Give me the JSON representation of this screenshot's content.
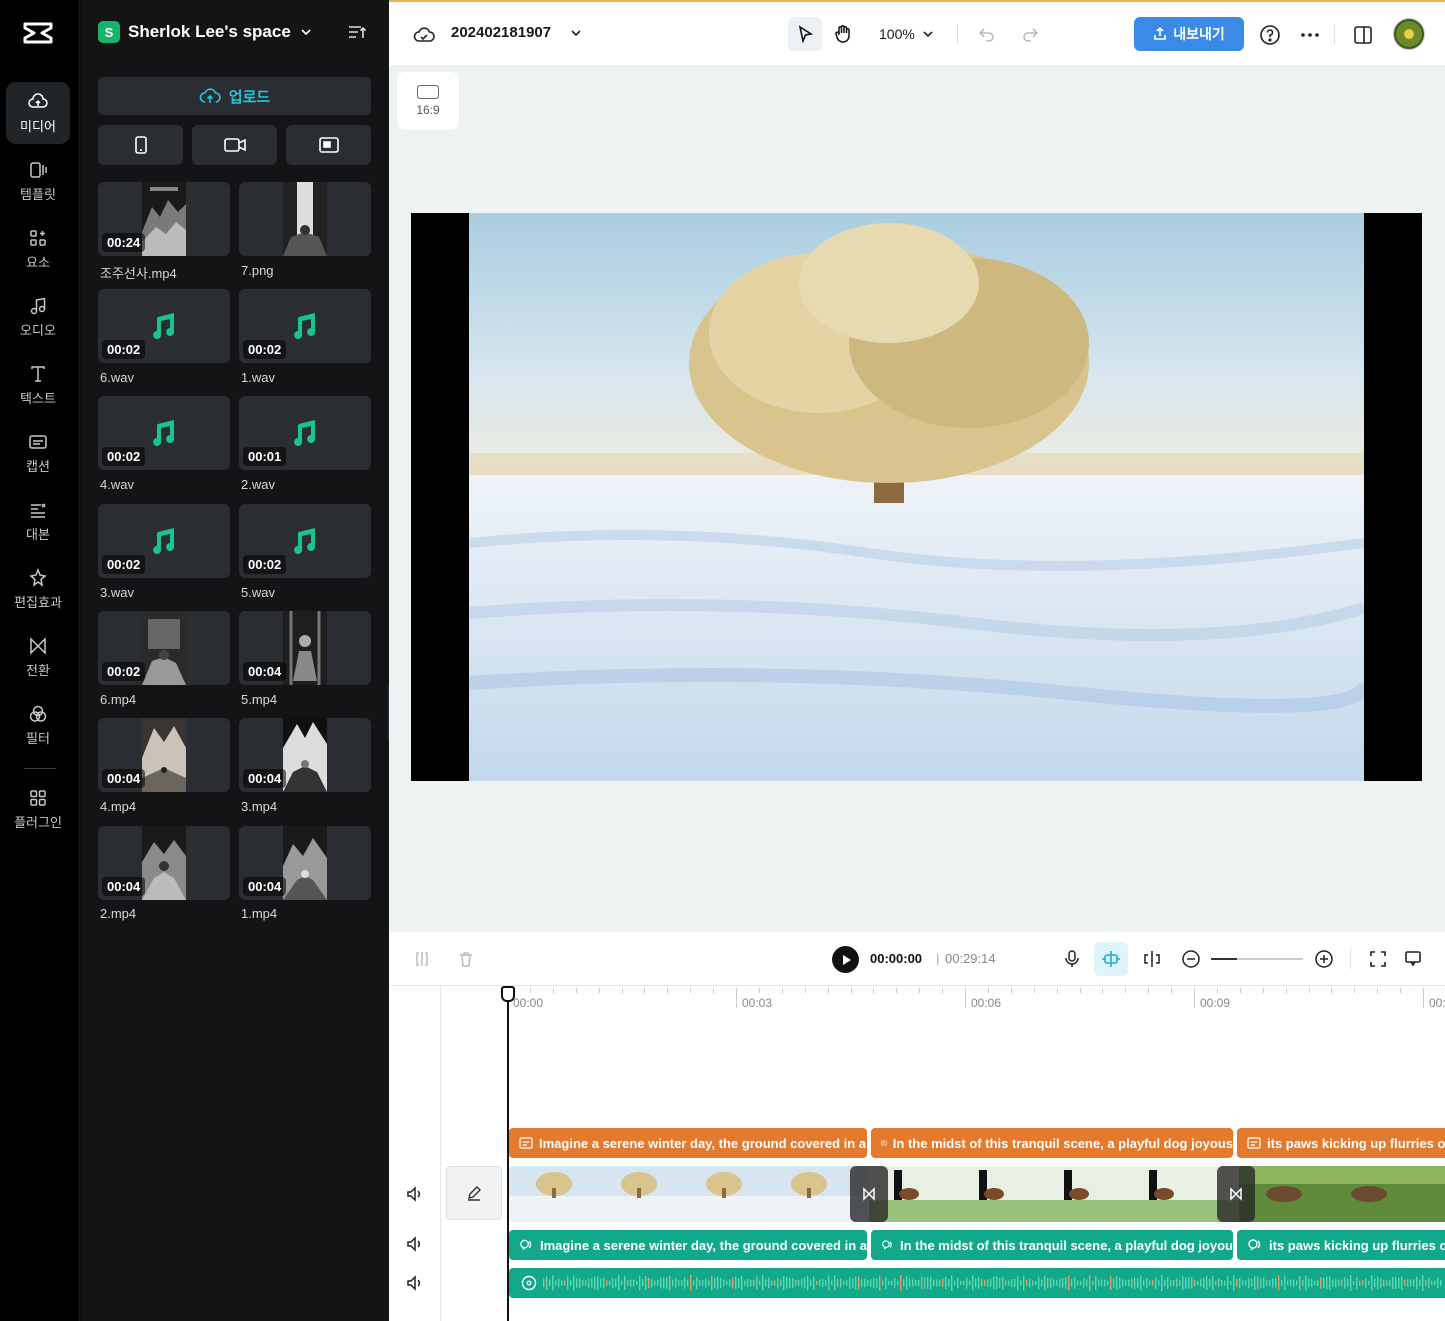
{
  "rail": {
    "items": [
      {
        "label": "미디어",
        "icon": "cloud-upload-icon"
      },
      {
        "label": "템플릿",
        "icon": "template-icon"
      },
      {
        "label": "요소",
        "icon": "elements-icon"
      },
      {
        "label": "오디오",
        "icon": "music-icon"
      },
      {
        "label": "텍스트",
        "icon": "text-icon"
      },
      {
        "label": "캡션",
        "icon": "caption-icon"
      },
      {
        "label": "대본",
        "icon": "script-icon"
      },
      {
        "label": "편집효과",
        "icon": "effects-icon"
      },
      {
        "label": "전환",
        "icon": "transition-icon"
      },
      {
        "label": "필터",
        "icon": "filter-icon"
      },
      {
        "label": "플러그인",
        "icon": "plugin-icon"
      }
    ]
  },
  "panel": {
    "space_initial": "S",
    "space_name": "Sherlok Lee's space",
    "upload_label": "업로드",
    "media": [
      {
        "name": "조주선사.mp4",
        "duration": "00:24",
        "kind": "video"
      },
      {
        "name": "7.png",
        "duration": "",
        "kind": "image"
      },
      {
        "name": "6.wav",
        "duration": "00:02",
        "kind": "audio"
      },
      {
        "name": "1.wav",
        "duration": "00:02",
        "kind": "audio"
      },
      {
        "name": "4.wav",
        "duration": "00:02",
        "kind": "audio"
      },
      {
        "name": "2.wav",
        "duration": "00:01",
        "kind": "audio"
      },
      {
        "name": "3.wav",
        "duration": "00:02",
        "kind": "audio"
      },
      {
        "name": "5.wav",
        "duration": "00:02",
        "kind": "audio"
      },
      {
        "name": "6.mp4",
        "duration": "00:02",
        "kind": "video"
      },
      {
        "name": "5.mp4",
        "duration": "00:04",
        "kind": "video"
      },
      {
        "name": "4.mp4",
        "duration": "00:04",
        "kind": "video"
      },
      {
        "name": "3.mp4",
        "duration": "00:04",
        "kind": "video"
      },
      {
        "name": "2.mp4",
        "duration": "00:04",
        "kind": "video"
      },
      {
        "name": "1.mp4",
        "duration": "00:04",
        "kind": "video"
      }
    ]
  },
  "topbar": {
    "project_name": "202402181907",
    "zoom": "100%",
    "export_label": "내보내기"
  },
  "canvas": {
    "ratio": "16:9"
  },
  "timeline": {
    "current_time": "00:00:00",
    "separator": "|",
    "total_time": "00:29:14",
    "ruler_labels": [
      "00:00",
      "00:03",
      "00:06",
      "00:09",
      "00:"
    ],
    "captions": [
      "Imagine a serene winter day, the ground covered in a",
      "In the midst of this tranquil scene, a playful dog joyous",
      "its paws kicking up flurries of"
    ],
    "voiceovers": [
      "Imagine a serene winter day, the ground covered in a",
      "In the midst of this tranquil scene, a playful dog joyou",
      "its paws kicking up flurries of"
    ]
  },
  "colors": {
    "accent": "#22c8e0",
    "caption_clip": "#e47a2e",
    "audio_clip": "#12a88a",
    "export_button": "#3a8be8",
    "space_badge": "#17b56b"
  }
}
